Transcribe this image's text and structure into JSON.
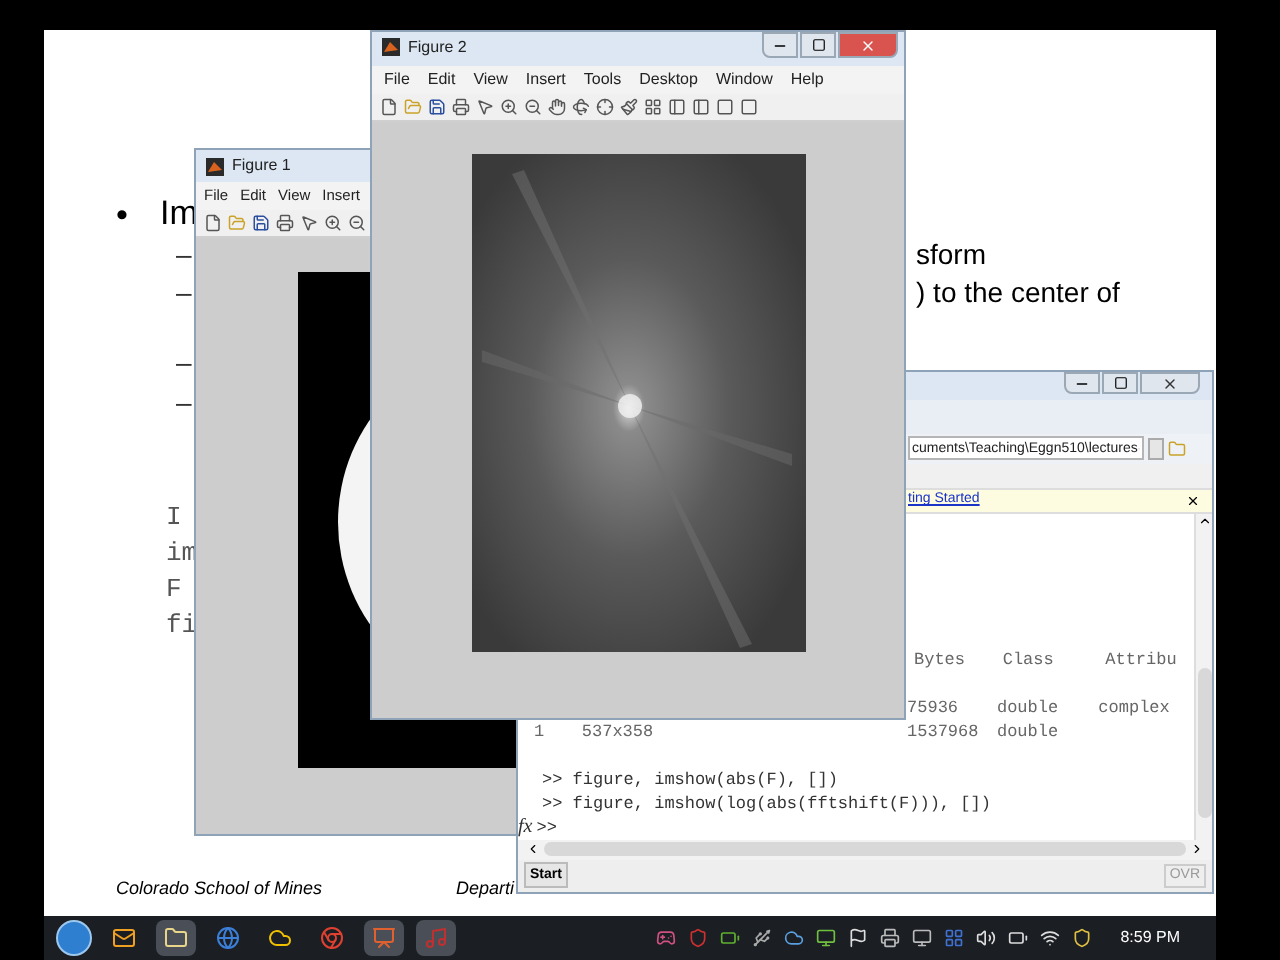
{
  "slide": {
    "bullet": "•",
    "heading": "Im",
    "dashes": [
      "–",
      "–",
      "–",
      "–"
    ],
    "line_1_tail": "sform",
    "line_2_tail": ") to the center of",
    "code_lines": [
      "I",
      "im",
      "F",
      "fi"
    ],
    "footer_left": "Colorado School of Mines",
    "footer_right": "Departi"
  },
  "figure_1": {
    "title": "Figure 1",
    "menu": [
      "File",
      "Edit",
      "View",
      "Insert"
    ]
  },
  "figure_2": {
    "title": "Figure 2",
    "menu": [
      "File",
      "Edit",
      "View",
      "Insert",
      "Tools",
      "Desktop",
      "Window",
      "Help"
    ]
  },
  "command_window": {
    "path": "cuments\\Teaching\\Eggn510\\lectures",
    "link": "ting Started",
    "table_header": [
      "Bytes",
      "Class",
      "Attribu"
    ],
    "rows": [
      [
        "",
        "",
        "75936",
        "double",
        "complex"
      ],
      [
        "1",
        "537x358",
        "1537968",
        "double",
        ""
      ]
    ],
    "commands": [
      ">> figure, imshow(abs(F), [])",
      ">> figure, imshow(log(abs(fftshift(F))), [])"
    ],
    "fx": "fx",
    "prompt": ">>",
    "start": "Start",
    "ovr": "OVR"
  },
  "taskbar": {
    "clock": "8:59 PM"
  }
}
